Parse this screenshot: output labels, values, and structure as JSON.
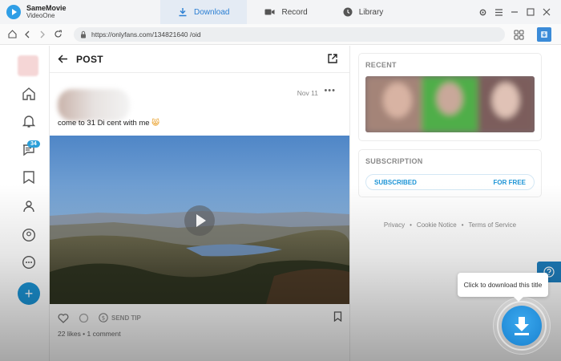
{
  "app": {
    "name_line1": "SameMovie",
    "name_line2": "VideoOne"
  },
  "tabs": [
    {
      "label": "Download",
      "icon": "download-icon",
      "active": true
    },
    {
      "label": "Record",
      "icon": "camera-icon",
      "active": false
    },
    {
      "label": "Library",
      "icon": "clock-icon",
      "active": false
    }
  ],
  "address": {
    "url": "https://onlyfans.com/134821640            /oid"
  },
  "nav": {
    "messages_badge": "34"
  },
  "feed": {
    "header_title": "POST",
    "post_date": "Nov 11",
    "caption": "come to 31 Di cent with me",
    "caption_emoji": "😸",
    "send_tip_label": "SEND TIP",
    "stats": "22 likes  •  1 comment"
  },
  "sidebar": {
    "recent_title": "RECENT",
    "subscription_title": "SUBSCRIPTION",
    "subscribed_label": "SUBSCRIBED",
    "price_label": "FOR FREE"
  },
  "footer": {
    "privacy": "Privacy",
    "cookie": "Cookie Notice",
    "terms": "Terms of Service",
    "sep": "•"
  },
  "download": {
    "tooltip": "Click to download this title"
  },
  "colors": {
    "accent": "#1b94d6",
    "download_button": "#2a95e2"
  }
}
